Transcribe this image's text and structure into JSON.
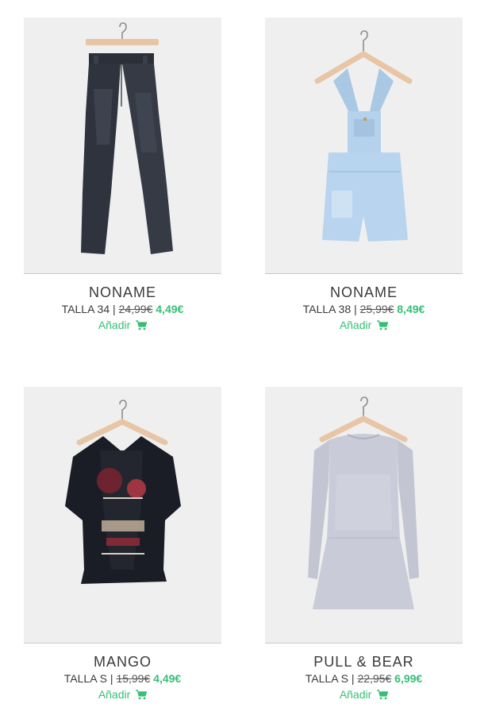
{
  "accent_color": "#35bf75",
  "products": [
    {
      "brand": "NONAME",
      "size": "TALLA 34",
      "separator": "|",
      "old_price": "24,99€",
      "price": "4,49€",
      "add_label": "Añadir",
      "add_icon": "shopping-cart-icon",
      "image": "dark-jeans-on-hanger"
    },
    {
      "brand": "NONAME",
      "size": "TALLA 38",
      "separator": "|",
      "old_price": "25,99€",
      "price": "8,49€",
      "add_label": "Añadir",
      "add_icon": "shopping-cart-icon",
      "image": "denim-short-overalls-on-hanger"
    },
    {
      "brand": "MANGO",
      "size": "TALLA S",
      "separator": "|",
      "old_price": "15,99€",
      "price": "4,49€",
      "add_label": "Añadir",
      "add_icon": "shopping-cart-icon",
      "image": "black-printed-top-on-hanger"
    },
    {
      "brand": "PULL & BEAR",
      "size": "TALLA S",
      "separator": "|",
      "old_price": "22,95€",
      "price": "6,99€",
      "add_label": "Añadir",
      "add_icon": "shopping-cart-icon",
      "image": "grey-knit-dress-on-hanger"
    }
  ]
}
